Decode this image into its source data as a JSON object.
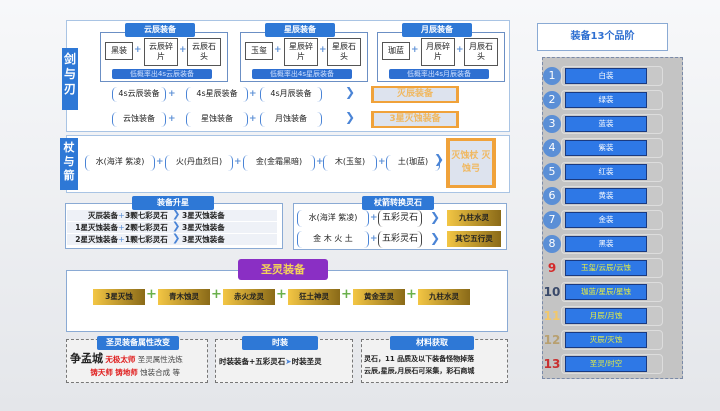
{
  "sword": {
    "label": "剑与刃",
    "groups": [
      {
        "title": "云辰装备",
        "items": [
          "黑装",
          "云辰碎片",
          "云辰石头"
        ],
        "note": "低概率出4s云辰装备"
      },
      {
        "title": "星辰装备",
        "items": [
          "玉玺",
          "星辰碎片",
          "星辰石头"
        ],
        "note": "低概率出4s星辰装备"
      },
      {
        "title": "月辰装备",
        "items": [
          "珈蓝",
          "月辰碎片",
          "月辰石头"
        ],
        "note": "低概率出4s月辰装备"
      }
    ],
    "row1": [
      "4s云辰装备",
      "4s星辰装备",
      "4s月辰装备"
    ],
    "row1_result": "灭辰装备",
    "row2": [
      "云蚀装备",
      "星蚀装备",
      "月蚀装备"
    ],
    "row2_result": "3星灭蚀装备"
  },
  "staff": {
    "label": "杖与箭",
    "items": [
      "水(海洋 紫凌)",
      "火(丹血烈日)",
      "金(金霜黑暗)",
      "木(玉玺)",
      "土(珈蓝)"
    ],
    "result": "灭蚀杖 灭蚀弓"
  },
  "upgrade": {
    "title": "装备升星",
    "rows": [
      [
        "灭辰装备",
        "3颗七彩灵石",
        "3星灭蚀装备"
      ],
      [
        "1星灭蚀装备",
        "2颗七彩灵石",
        "3星灭蚀装备"
      ],
      [
        "2星灭蚀装备",
        "1颗七彩灵石",
        "3星灭蚀装备"
      ]
    ]
  },
  "convert": {
    "title": "杖箭转换灵石",
    "rows": [
      [
        "水(海洋 紫凌)",
        "五彩灵石",
        "九柱水灵"
      ],
      [
        "金 木 火 土",
        "五彩灵石",
        "其它五行灵"
      ]
    ]
  },
  "holy": {
    "title": "圣灵装备",
    "items": [
      "3星灭蚀",
      "青木蚀灵",
      "赤火龙灵",
      "狂土神灵",
      "黄金圣灵",
      "九柱水灵"
    ]
  },
  "attr": {
    "title": "圣灵装备属性改变",
    "city": "争孟城",
    "npc1": "无极太师",
    "text1": "圣灵属性洗炼",
    "npc2": "铸天师",
    "npc3": "铸地师",
    "text2": "蚀装合成 等"
  },
  "fashion": {
    "title": "时装",
    "left": "时装装备+五彩灵石",
    "right": "时装圣灵"
  },
  "material": {
    "title": "材料获取",
    "line1": "灵石，11 品质及以下装备怪物掉落",
    "line2": "云辰,星辰,月辰石可采集，彩石商城"
  },
  "tiers": {
    "title": "装备13个品阶",
    "items": [
      {
        "n": "1",
        "label": "白装"
      },
      {
        "n": "2",
        "label": "绿装"
      },
      {
        "n": "3",
        "label": "蓝装"
      },
      {
        "n": "4",
        "label": "紫装"
      },
      {
        "n": "5",
        "label": "红装"
      },
      {
        "n": "6",
        "label": "黄装"
      },
      {
        "n": "7",
        "label": "金装"
      },
      {
        "n": "8",
        "label": "黑装"
      },
      {
        "n": "9",
        "label": "玉玺/云辰/云蚀",
        "color": "#d42a2a"
      },
      {
        "n": "10",
        "label": "珈蓝/星辰/星蚀",
        "color": "#3a4a6a"
      },
      {
        "n": "11",
        "label": "月辰/月蚀",
        "color": "#f2c86a"
      },
      {
        "n": "12",
        "label": "灭辰/灭蚀",
        "color": "#b8a070"
      },
      {
        "n": "13",
        "label": "圣灵/时空",
        "color": "#c83030"
      }
    ]
  }
}
